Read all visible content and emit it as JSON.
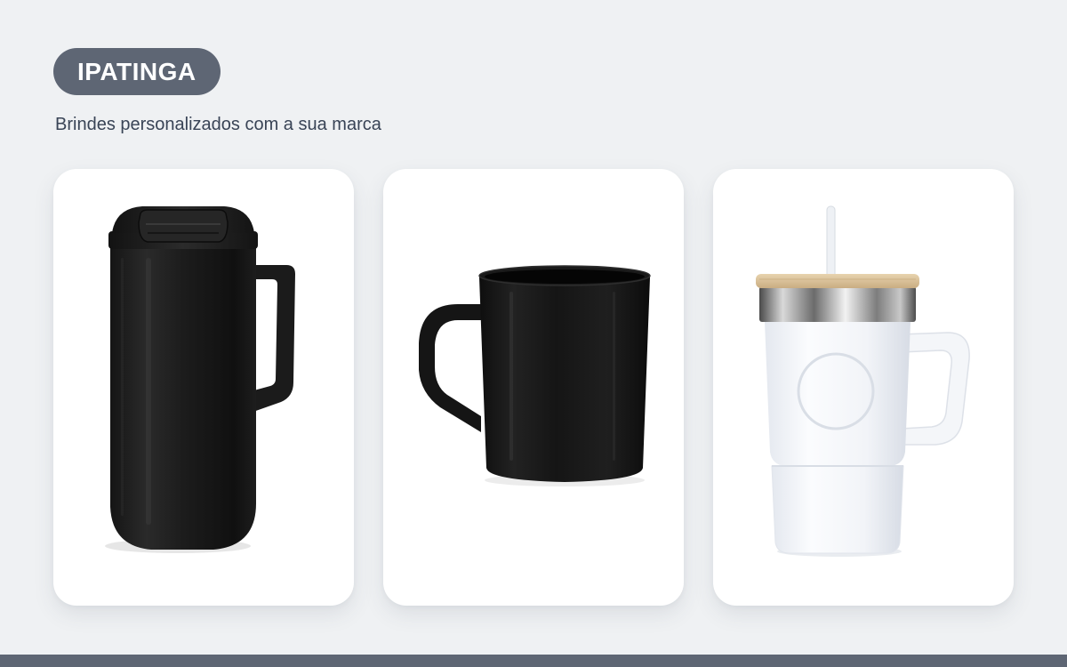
{
  "header": {
    "badge_label": "IPATINGA",
    "subtitle": "Brindes personalizados com a sua marca"
  },
  "colors": {
    "background": "#eff1f3",
    "badge": "#5e6674",
    "subtitle_text": "#394456",
    "card": "#ffffff",
    "bottom_bar": "#5e6674"
  },
  "products": [
    {
      "image": "black-thermal-mug-with-flip-lid"
    },
    {
      "image": "black-plastic-mug"
    },
    {
      "image": "white-tumbler-with-bamboo-lid-and-straw"
    }
  ]
}
